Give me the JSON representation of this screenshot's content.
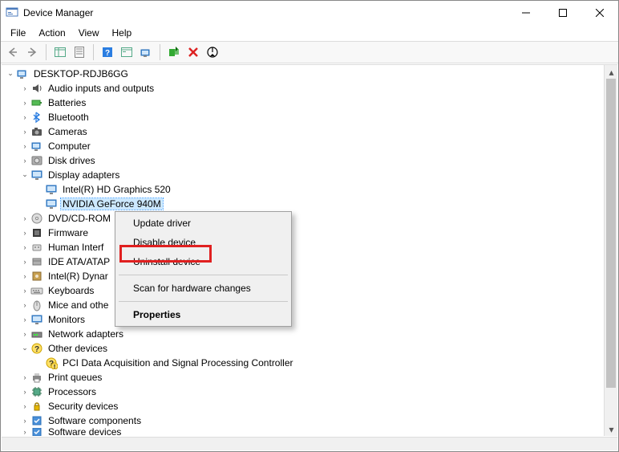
{
  "window": {
    "title": "Device Manager"
  },
  "menu": {
    "file": "File",
    "action": "Action",
    "view": "View",
    "help": "Help"
  },
  "root": {
    "name": "DESKTOP-RDJB6GG"
  },
  "categories": [
    {
      "label": "Audio inputs and outputs",
      "exp": "closed"
    },
    {
      "label": "Batteries",
      "exp": "closed"
    },
    {
      "label": "Bluetooth",
      "exp": "closed"
    },
    {
      "label": "Cameras",
      "exp": "closed"
    },
    {
      "label": "Computer",
      "exp": "closed"
    },
    {
      "label": "Disk drives",
      "exp": "closed"
    },
    {
      "label": "Display adapters",
      "exp": "open",
      "children": [
        {
          "label": "Intel(R) HD Graphics 520"
        },
        {
          "label": "NVIDIA GeForce 940M",
          "selected": true
        }
      ]
    },
    {
      "label": "DVD/CD-ROM",
      "exp": "closed",
      "truncated": true
    },
    {
      "label": "Firmware",
      "exp": "closed"
    },
    {
      "label": "Human Interf",
      "exp": "closed",
      "truncated": true
    },
    {
      "label": "IDE ATA/ATAP",
      "exp": "closed",
      "truncated": true
    },
    {
      "label": "Intel(R) Dynar",
      "exp": "closed",
      "truncated": true
    },
    {
      "label": "Keyboards",
      "exp": "closed"
    },
    {
      "label": "Mice and othe",
      "exp": "closed",
      "truncated": true
    },
    {
      "label": "Monitors",
      "exp": "closed"
    },
    {
      "label": "Network adapters",
      "exp": "closed"
    },
    {
      "label": "Other devices",
      "exp": "open",
      "children": [
        {
          "label": "PCI Data Acquisition and Signal Processing Controller",
          "warn": true
        }
      ]
    },
    {
      "label": "Print queues",
      "exp": "closed"
    },
    {
      "label": "Processors",
      "exp": "closed"
    },
    {
      "label": "Security devices",
      "exp": "closed"
    },
    {
      "label": "Software components",
      "exp": "closed"
    },
    {
      "label": "Software devices",
      "exp": "closed",
      "partial": true
    }
  ],
  "context_menu": {
    "items": [
      {
        "label": "Update driver"
      },
      {
        "label": "Disable device"
      },
      {
        "label": "Uninstall device",
        "highlighted": true
      },
      {
        "sep": true
      },
      {
        "label": "Scan for hardware changes"
      },
      {
        "sep": true
      },
      {
        "label": "Properties",
        "bold": true
      }
    ]
  }
}
